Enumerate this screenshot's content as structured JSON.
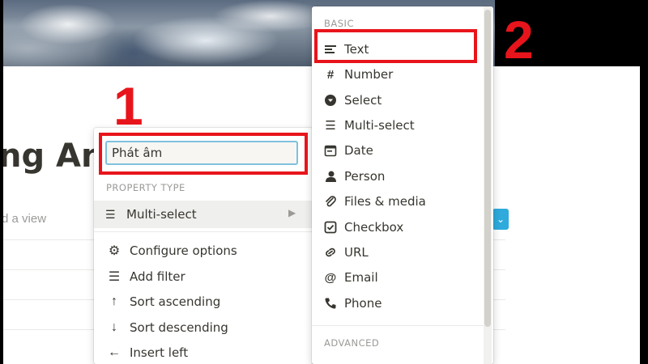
{
  "page": {
    "title": "ng Anh",
    "add_view": "d a view"
  },
  "property_menu": {
    "name_value": "Phát âm",
    "property_type_label": "PROPERTY TYPE",
    "current_type": "Multi-select",
    "items": [
      {
        "label": "Configure options",
        "icon": "gear-icon"
      },
      {
        "label": "Add filter",
        "icon": "filter-icon"
      },
      {
        "label": "Sort ascending",
        "icon": "arrow-up-icon"
      },
      {
        "label": "Sort descending",
        "icon": "arrow-down-icon"
      },
      {
        "label": "Insert left",
        "icon": "arrow-left-icon"
      }
    ]
  },
  "type_menu": {
    "basic_label": "BASIC",
    "advanced_label": "ADVANCED",
    "items": [
      {
        "label": "Text",
        "icon": "text-lines-icon"
      },
      {
        "label": "Number",
        "icon": "hash-icon"
      },
      {
        "label": "Select",
        "icon": "select-circle-icon"
      },
      {
        "label": "Multi-select",
        "icon": "list-icon"
      },
      {
        "label": "Date",
        "icon": "calendar-icon"
      },
      {
        "label": "Person",
        "icon": "person-icon"
      },
      {
        "label": "Files & media",
        "icon": "paperclip-icon"
      },
      {
        "label": "Checkbox",
        "icon": "checkbox-icon"
      },
      {
        "label": "URL",
        "icon": "link-icon"
      },
      {
        "label": "Email",
        "icon": "at-icon"
      },
      {
        "label": "Phone",
        "icon": "phone-icon"
      }
    ]
  },
  "annotations": {
    "step1": "1",
    "step2": "2",
    "highlight_color": "#e8141b"
  },
  "colors": {
    "input_border": "#7fc1dd",
    "accent_blue": "#2eaadc"
  }
}
